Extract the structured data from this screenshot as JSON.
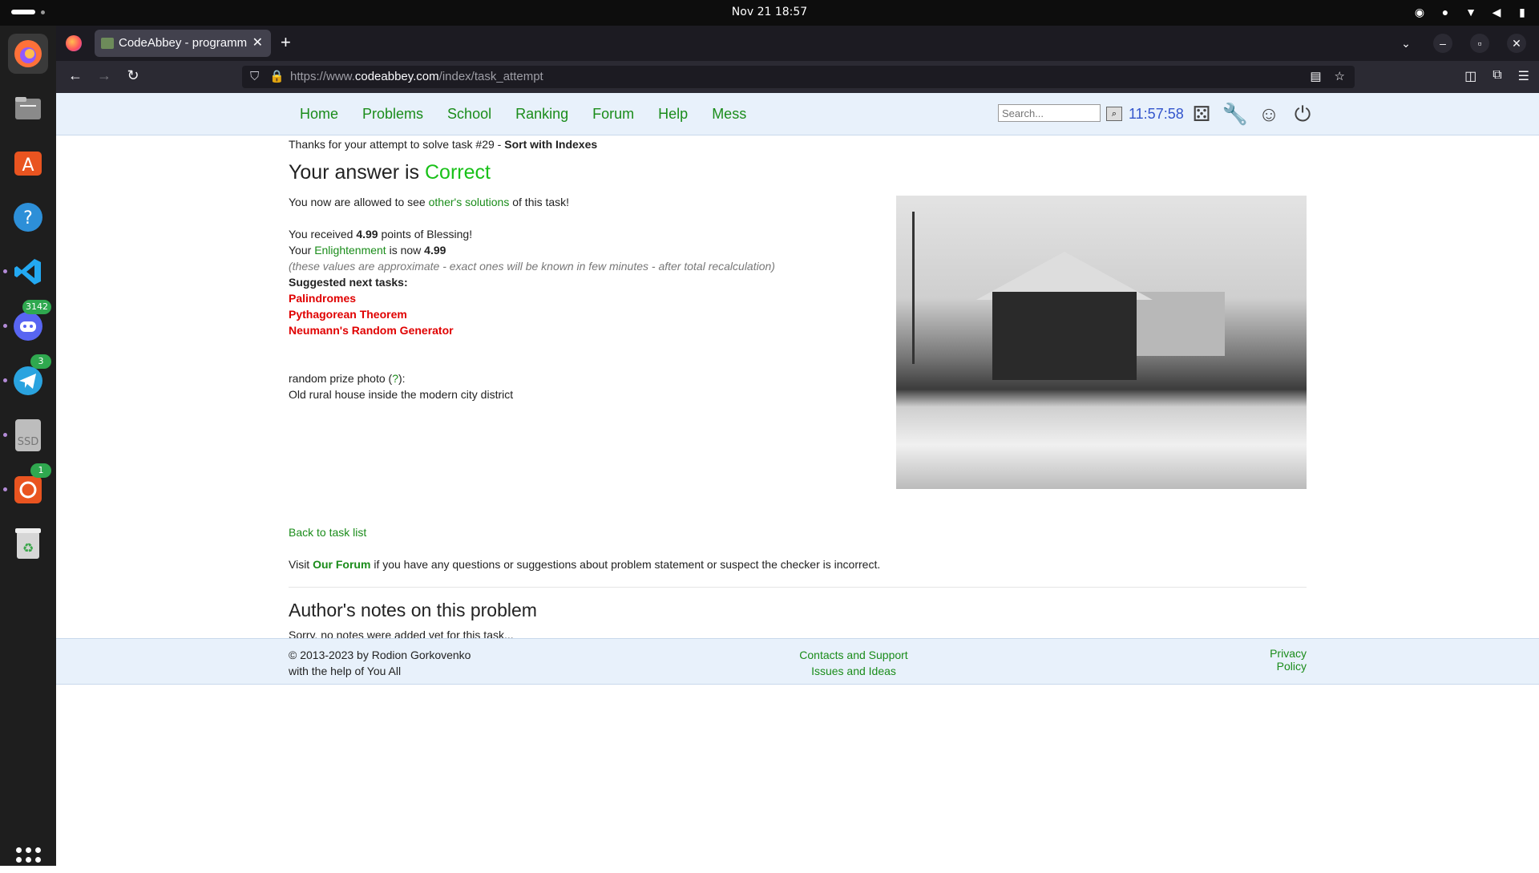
{
  "system": {
    "clock": "Nov 21  18:57",
    "dock_badges": {
      "discord": "3142",
      "telegram": "3",
      "ubuntu_software": "1"
    },
    "ssd_label": "SSD"
  },
  "browser": {
    "tab_title": "CodeAbbey - programmi",
    "url_prefix": "https://www.",
    "url_host": "codeabbey.com",
    "url_path": "/index/task_attempt"
  },
  "site": {
    "menu": [
      "Home",
      "Problems",
      "School",
      "Ranking",
      "Forum",
      "Help",
      "Mess"
    ],
    "search_placeholder": "Search...",
    "server_time": "11:57:58"
  },
  "result": {
    "thanks_prefix": "Thanks for your attempt to solve task #29 - ",
    "task_name": "Sort with Indexes",
    "answer_prefix": "Your answer is ",
    "answer_status": "Correct",
    "allowed_prefix": "You now are allowed to see ",
    "allowed_link": "other's solutions",
    "allowed_suffix": " of this task!",
    "received_prefix": "You received ",
    "received_points": "4.99",
    "received_suffix": " points of Blessing!",
    "enl_prefix": "Your ",
    "enl_link": "Enlightenment",
    "enl_middle": " is now ",
    "enl_value": "4.99",
    "approx_note": "(these values are approximate - exact ones will be known in few minutes - after total recalculation)",
    "suggested_title": "Suggested next tasks:",
    "suggested": [
      "Palindromes",
      "Pythagorean Theorem",
      "Neumann's Random Generator"
    ],
    "photo_prefix": "random prize photo (",
    "photo_q": "?",
    "photo_suffix": "):",
    "photo_caption": "Old rural house inside the modern city district",
    "back_link": "Back to task list",
    "visit_prefix": "Visit ",
    "visit_link": "Our Forum",
    "visit_suffix": " if you have any questions or suggestions about problem statement or suspect the checker is incorrect.",
    "author_title": "Author's notes on this problem",
    "author_note": "Sorry, no notes were added yet for this task..."
  },
  "footer": {
    "copyright": "© 2013-2023 by Rodion Gorkovenko",
    "help": "with the help of You All",
    "contacts": "Contacts and Support",
    "issues": "Issues and Ideas",
    "privacy": "Privacy Policy"
  }
}
